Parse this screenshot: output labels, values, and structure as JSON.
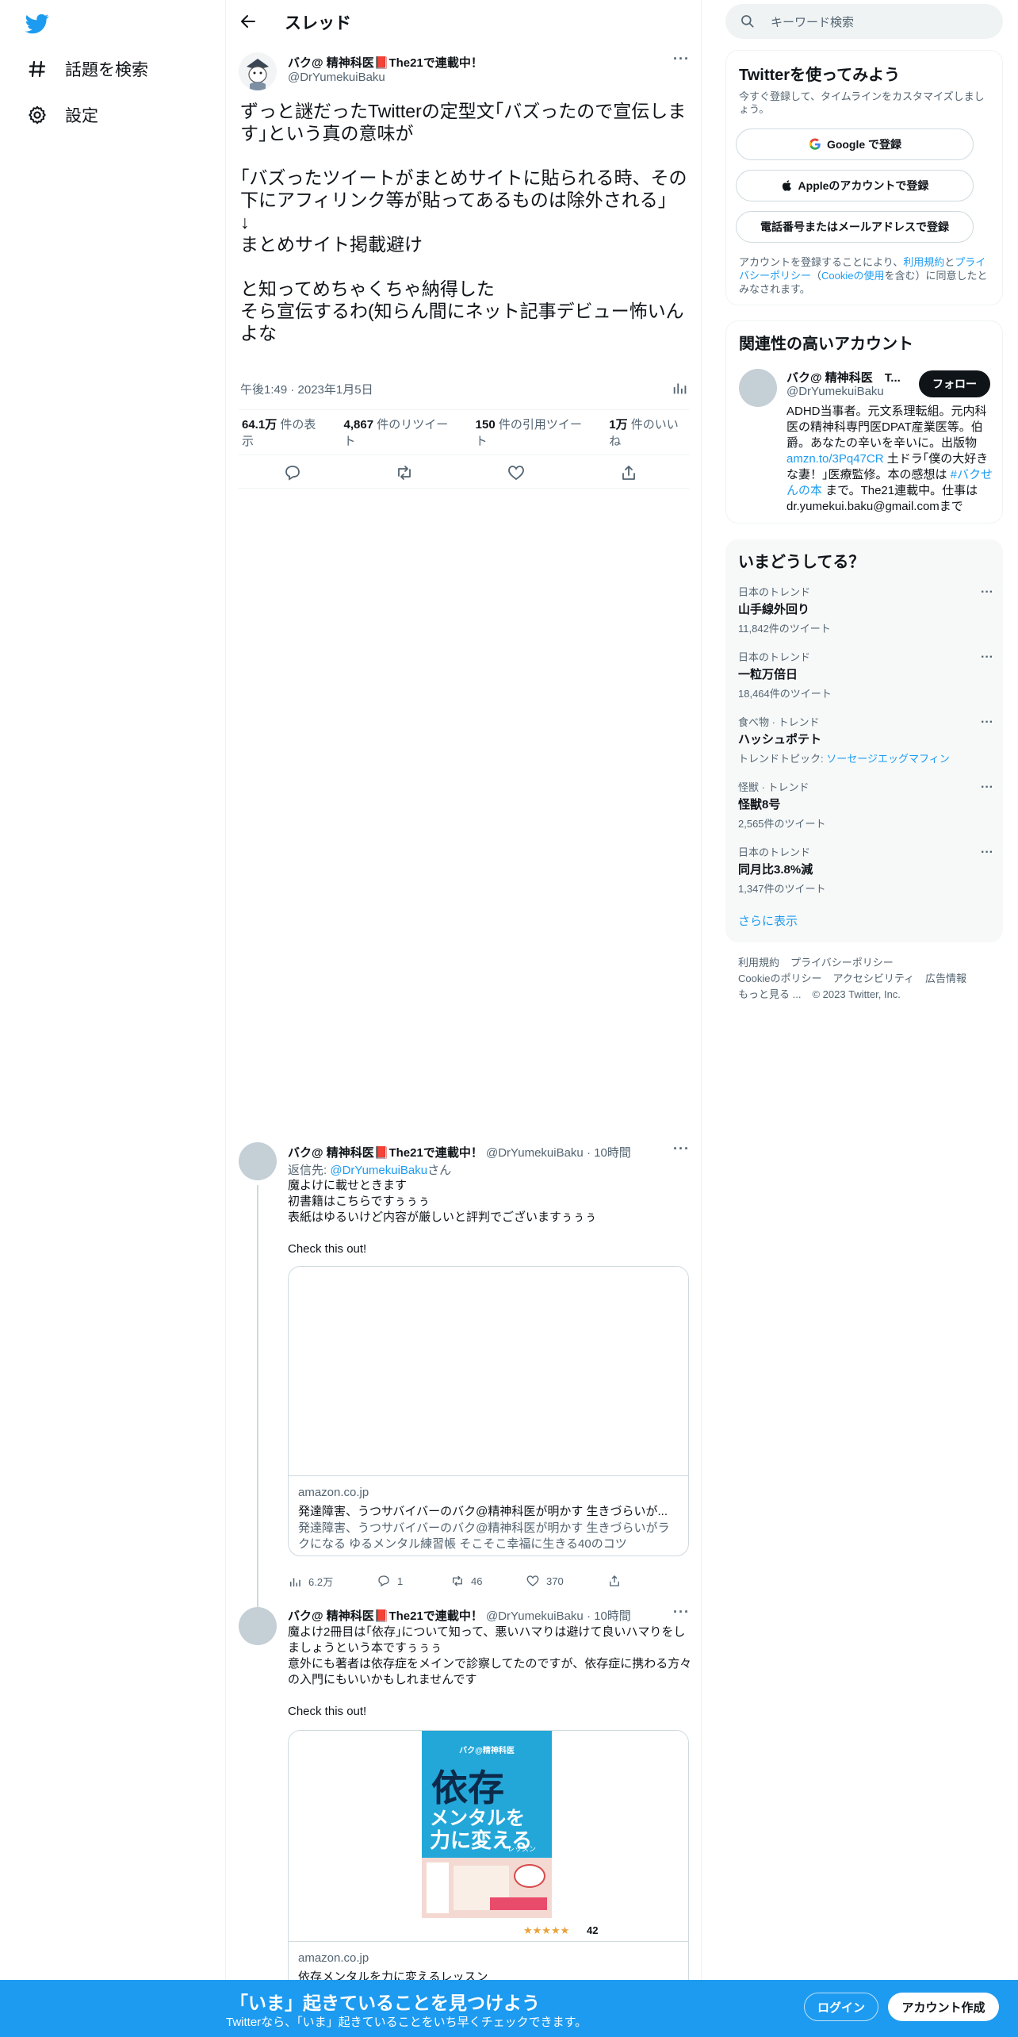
{
  "nav": {
    "explore_label": "話題を検索",
    "settings_label": "設定"
  },
  "thread": {
    "title": "スレッド",
    "author_name": "バク@ 精神科医📕The21で連載中！",
    "author_handle": "@DrYumekuiBaku",
    "text": "ずっと謎だったTwitterの定型文｢バズったので宣伝します｣という真の意味が\n\n｢バズったツイートがまとめサイトに貼られる時、その下にアフィリンク等が貼ってあるものは除外される｣\n↓\nまとめサイト掲載避け\n\nと知ってめちゃくちゃ納得した\nそら宣伝するわ(知らん間にネット記事デビュー怖いんよな",
    "timestamp": "午後1:49 · 2023年1月5日",
    "stats": {
      "views_num": "64.1万",
      "views_label": "件の表示",
      "retweets_num": "4,867",
      "retweets_label": "件のリツイート",
      "quotes_num": "150",
      "quotes_label": "件の引用ツイート",
      "likes_num": "1万",
      "likes_label": "件のいいね"
    }
  },
  "replies": [
    {
      "name": "バク@ 精神科医📕The21で連載中！",
      "handle": "@DrYumekuiBaku",
      "time": "10時間",
      "replying_prefix": "返信先: ",
      "replying_to": "@DrYumekuiBaku",
      "replying_suffix": "さん",
      "text": "魔よけに載せときます\n初書籍はこちらですぅぅぅ\n表紙はゆるいけど内容が厳しいと評判でございますぅぅぅ\n\nCheck this out!",
      "card_domain": "amazon.co.jp",
      "card_title": "発達障害、うつサバイバーのバク@精神科医が明かす 生きづらいが...",
      "card_desc": "発達障害、うつサバイバーのバク@精神科医が明かす 生きづらいがラクになる ゆるメンタル練習帳 そこそこ幸福に生きる40のコツ",
      "views": "6.2万",
      "replies_count": "1",
      "retweets": "46",
      "likes": "370"
    },
    {
      "name": "バク@ 精神科医📕The21で連載中！",
      "handle": "@DrYumekuiBaku",
      "time": "10時間",
      "text": "魔よけ2冊目は｢依存｣について知って、悪いハマりは避けて良いハマりをしましょうという本ですぅぅぅ\n意外にも著者は依存症をメインで診察してたのですが、依存症に携わる方々の入門にもいいかもしれませんです\n\nCheck this out!",
      "book_author": "バク@精神科医",
      "book_title_1": "依存",
      "book_title_2": "メンタルを",
      "book_title_3": "力に変える",
      "book_title_4": "レッスン",
      "book_rating": "42",
      "card_domain": "amazon.co.jp",
      "card_title": "依存メンタルを力に変えるレッスン"
    }
  ],
  "right": {
    "search_placeholder": "キーワード検索",
    "signup": {
      "title": "Twitterを使ってみよう",
      "subtitle": "今すぐ登録して、タイムラインをカスタマイズしましょう。",
      "google_btn": "Google で登録",
      "apple_btn": "Appleのアカウントで登録",
      "phone_btn": "電話番号またはメールアドレスで登録",
      "legal_1": "アカウントを登録することにより、",
      "legal_terms": "利用規約",
      "legal_2": "と",
      "legal_privacy": "プライバシーポリシー",
      "legal_3": "（",
      "legal_cookie": "Cookieの使用",
      "legal_4": "を含む）に同意したとみなされます。"
    },
    "related": {
      "title": "関連性の高いアカウント",
      "name": "バク@ 精神科医　T...",
      "handle": "@DrYumekuiBaku",
      "follow": "フォロー",
      "bio_1": "ADHD当事者。元文系理転組。元内科医の精神科専門医DPAT産業医等。伯爵。あなたの辛いを辛いに。出版物",
      "bio_link": "amzn.to/3Pq47CR",
      "bio_2": " 土ドラ｢僕の大好きな妻！｣医療監修。本の感想は ",
      "bio_tag": "#バクせんの本",
      "bio_3": " まで。The21連載中。仕事はdr.yumekui.baku@gmail.comまで"
    },
    "trends": {
      "title": "いまどうしてる？",
      "items": [
        {
          "ctx": "日本のトレンド",
          "name": "山手線外回り",
          "count": "11,842件のツイート"
        },
        {
          "ctx": "日本のトレンド",
          "name": "一粒万倍日",
          "count": "18,464件のツイート"
        },
        {
          "ctx": "食べ物 · トレンド",
          "name": "ハッシュポテト",
          "count_prefix": "トレンドトピック: ",
          "count_link": "ソーセージエッグマフィン"
        },
        {
          "ctx": "怪獣 · トレンド",
          "name": "怪獣8号",
          "count": "2,565件のツイート"
        },
        {
          "ctx": "日本のトレンド",
          "name": "同月比3.8%減",
          "count": "1,347件のツイート"
        }
      ],
      "show_more": "さらに表示"
    },
    "footer": {
      "terms": "利用規約",
      "privacy": "プライバシーポリシー",
      "cookie": "Cookieのポリシー",
      "accessibility": "アクセシビリティ",
      "ads": "広告情報",
      "more": "もっと見る ...",
      "copyright": "© 2023 Twitter, Inc."
    }
  },
  "bottom_bar": {
    "title": "「いま」起きていることを見つけよう",
    "subtitle": "Twitterなら、「いま」起きていることをいち早くチェックできます。",
    "login": "ログイン",
    "signup": "アカウント作成"
  },
  "colors": {
    "accent": "#1d9bf0",
    "text": "#0f1419",
    "muted": "#536471",
    "border": "#eff3f4"
  }
}
